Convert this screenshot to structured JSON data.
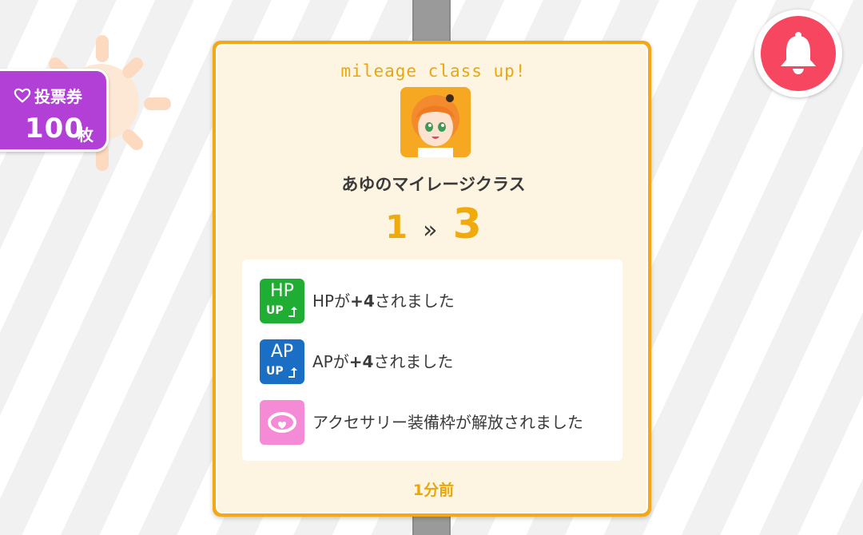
{
  "ticket": {
    "label": "投票券",
    "count": "100",
    "unit": "枚",
    "icon": "heart-icon"
  },
  "notification": {
    "icon": "bell-icon",
    "color": "#f7465f"
  },
  "card": {
    "title": "mileage class up!",
    "character_name": "あゆのマイレージクラス",
    "class_from": "1",
    "class_arrow": "»",
    "class_to": "3",
    "items": [
      {
        "icon_big": "HP",
        "icon_small": "UP",
        "icon_color": "#1fae33",
        "prefix": "HPが",
        "value": "+4",
        "suffix": "されました"
      },
      {
        "icon_big": "AP",
        "icon_small": "UP",
        "icon_color": "#1a6fc4",
        "prefix": "APが",
        "value": "+4",
        "suffix": "されました"
      },
      {
        "icon": "accessory-ring-icon",
        "icon_color": "#f58bd6",
        "text": "アクセサリー装備枠が解放されました"
      }
    ],
    "time": "1分前"
  }
}
